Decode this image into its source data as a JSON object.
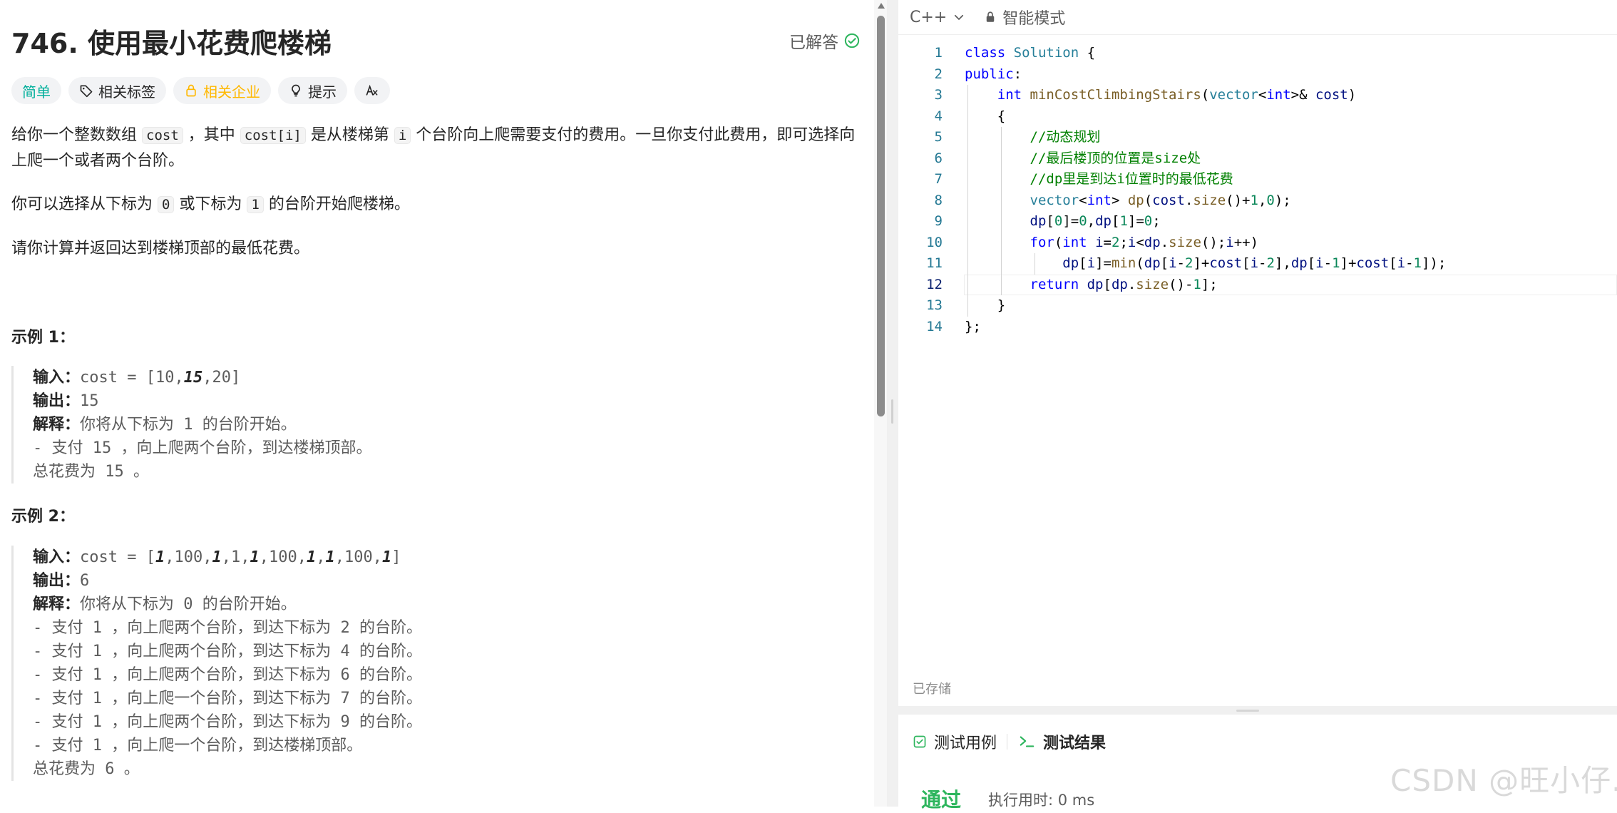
{
  "problem": {
    "title": "746. 使用最小花费爬楼梯",
    "status": "已解答",
    "tags": {
      "difficulty": "简单",
      "related_tags": "相关标签",
      "related_companies": "相关企业",
      "hint": "提示"
    },
    "description": {
      "p1_a": "给你一个整数数组 ",
      "p1_code1": "cost",
      "p1_b": " ，其中 ",
      "p1_code2": "cost[i]",
      "p1_c": " 是从楼梯第 ",
      "p1_code3": "i",
      "p1_d": " 个台阶向上爬需要支付的费用。一旦你支付此费用，即可选择向上爬一个或者两个台阶。",
      "p2_a": "你可以选择从下标为 ",
      "p2_code1": "0",
      "p2_b": " 或下标为 ",
      "p2_code2": "1",
      "p2_c": " 的台阶开始爬楼梯。",
      "p3": "请你计算并返回达到楼梯顶部的最低花费。"
    },
    "example1": {
      "title": "示例 1：",
      "input_label": "输入：",
      "input_a": "cost = [10,",
      "input_em": "15",
      "input_b": ",20]",
      "output_label": "输出：",
      "output": "15",
      "explain_label": "解释：",
      "explain": "你将从下标为 1 的台阶开始。",
      "lines": [
        "- 支付 15 ，向上爬两个台阶，到达楼梯顶部。",
        "总花费为 15 。"
      ]
    },
    "example2": {
      "title": "示例 2：",
      "input_label": "输入：",
      "input_parts": [
        "cost = [",
        "1",
        ",100,",
        "1",
        ",1,",
        "1",
        ",100,",
        "1",
        ",",
        "1",
        ",100,",
        "1",
        "]"
      ],
      "output_label": "输出：",
      "output": "6",
      "explain_label": "解释：",
      "explain": "你将从下标为 0 的台阶开始。",
      "lines": [
        "- 支付 1 ，向上爬两个台阶，到达下标为 2 的台阶。",
        "- 支付 1 ，向上爬两个台阶，到达下标为 4 的台阶。",
        "- 支付 1 ，向上爬两个台阶，到达下标为 6 的台阶。",
        "- 支付 1 ，向上爬一个台阶，到达下标为 7 的台阶。",
        "- 支付 1 ，向上爬两个台阶，到达下标为 9 的台阶。",
        "- 支付 1 ，向上爬一个台阶，到达楼梯顶部。",
        "总花费为 6 。"
      ]
    }
  },
  "editor": {
    "language": "C++",
    "mode": "智能模式",
    "saved_status": "已存储",
    "code_lines": [
      "class Solution {",
      "public:",
      "    int minCostClimbingStairs(vector<int>& cost)",
      "    {",
      "        //动态规划",
      "        //最后楼顶的位置是size处",
      "        //dp里是到达i位置时的最低花费",
      "        vector<int> dp(cost.size()+1,0);",
      "        dp[0]=0,dp[1]=0;",
      "        for(int i=2;i<dp.size();i++)",
      "            dp[i]=min(dp[i-2]+cost[i-2],dp[i-1]+cost[i-1]);",
      "        return dp[dp.size()-1];",
      "    }",
      "};"
    ],
    "line_numbers": [
      "1",
      "2",
      "3",
      "4",
      "5",
      "6",
      "7",
      "8",
      "9",
      "10",
      "11",
      "12",
      "13",
      "14"
    ]
  },
  "bottom_panel": {
    "tab_testcase": "测试用例",
    "tab_result": "测试结果",
    "result": "通过",
    "runtime": "执行用时: 0 ms"
  },
  "watermark": "CSDN @旺小仔."
}
